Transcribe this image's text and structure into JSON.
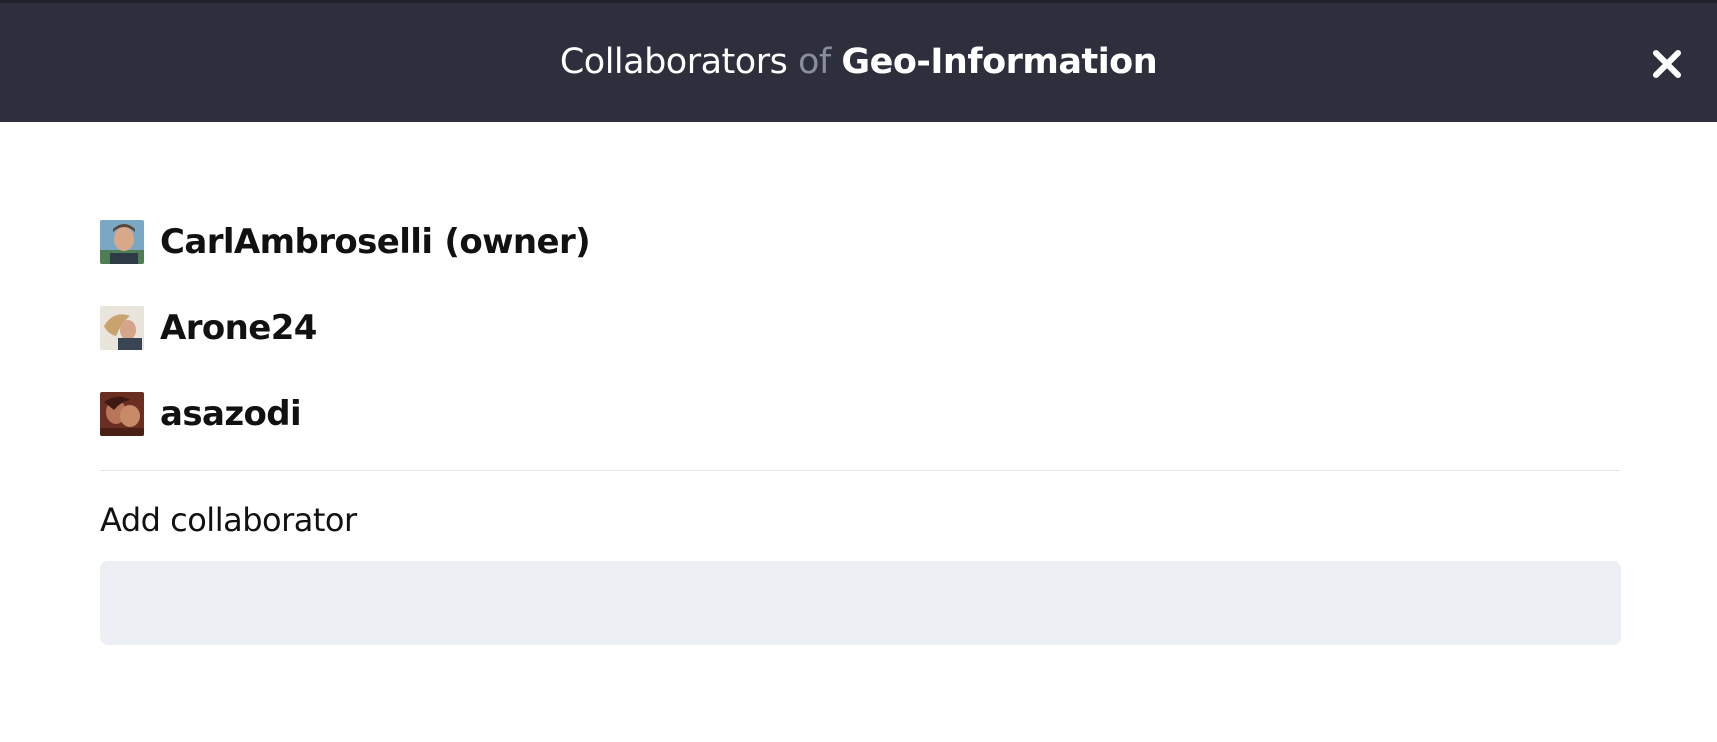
{
  "modal": {
    "title_prefix": "Collaborators",
    "title_of": "of",
    "project_name": "Geo-Information",
    "close_icon": "close-icon"
  },
  "collaborators": [
    {
      "username": "CarlAmbroselli",
      "role_tag": "(owner)",
      "avatar": "avatar-photo-man"
    },
    {
      "username": "Arone24",
      "role_tag": "",
      "avatar": "avatar-photo-woman"
    },
    {
      "username": "asazodi",
      "role_tag": "",
      "avatar": "avatar-photo-couple"
    }
  ],
  "add_collaborator": {
    "label": "Add collaborator",
    "value": "",
    "placeholder": ""
  },
  "colors": {
    "header_bg": "#2d2f3d",
    "title_muted": "#8a8d9a",
    "input_bg": "#eceff3",
    "divider": "#e3e5ea"
  }
}
